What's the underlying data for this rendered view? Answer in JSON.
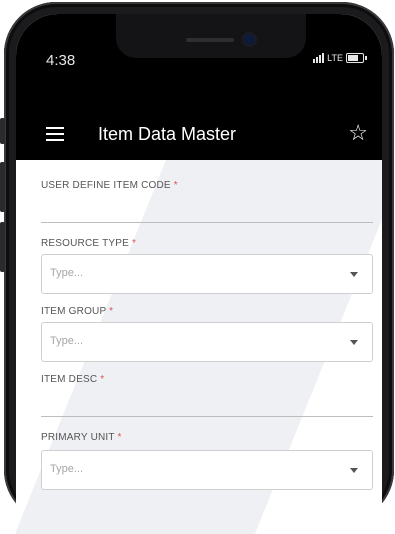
{
  "status": {
    "time": "4:38",
    "network": "LTE"
  },
  "appbar": {
    "title": "Item Data Master"
  },
  "fields": [
    {
      "label": "USER DEFINE ITEM CODE",
      "required": "*"
    },
    {
      "label": "RESOURCE TYPE",
      "required": "*",
      "placeholder": "Type..."
    },
    {
      "label": "ITEM GROUP",
      "required": "*",
      "placeholder": "Type..."
    },
    {
      "label": "ITEM DESC",
      "required": "*"
    },
    {
      "label": "PRIMARY UNIT",
      "required": "*",
      "placeholder": "Type..."
    }
  ],
  "colors": {
    "appbar": "#000000",
    "required": "#d9534f",
    "background": "#ffffff"
  }
}
